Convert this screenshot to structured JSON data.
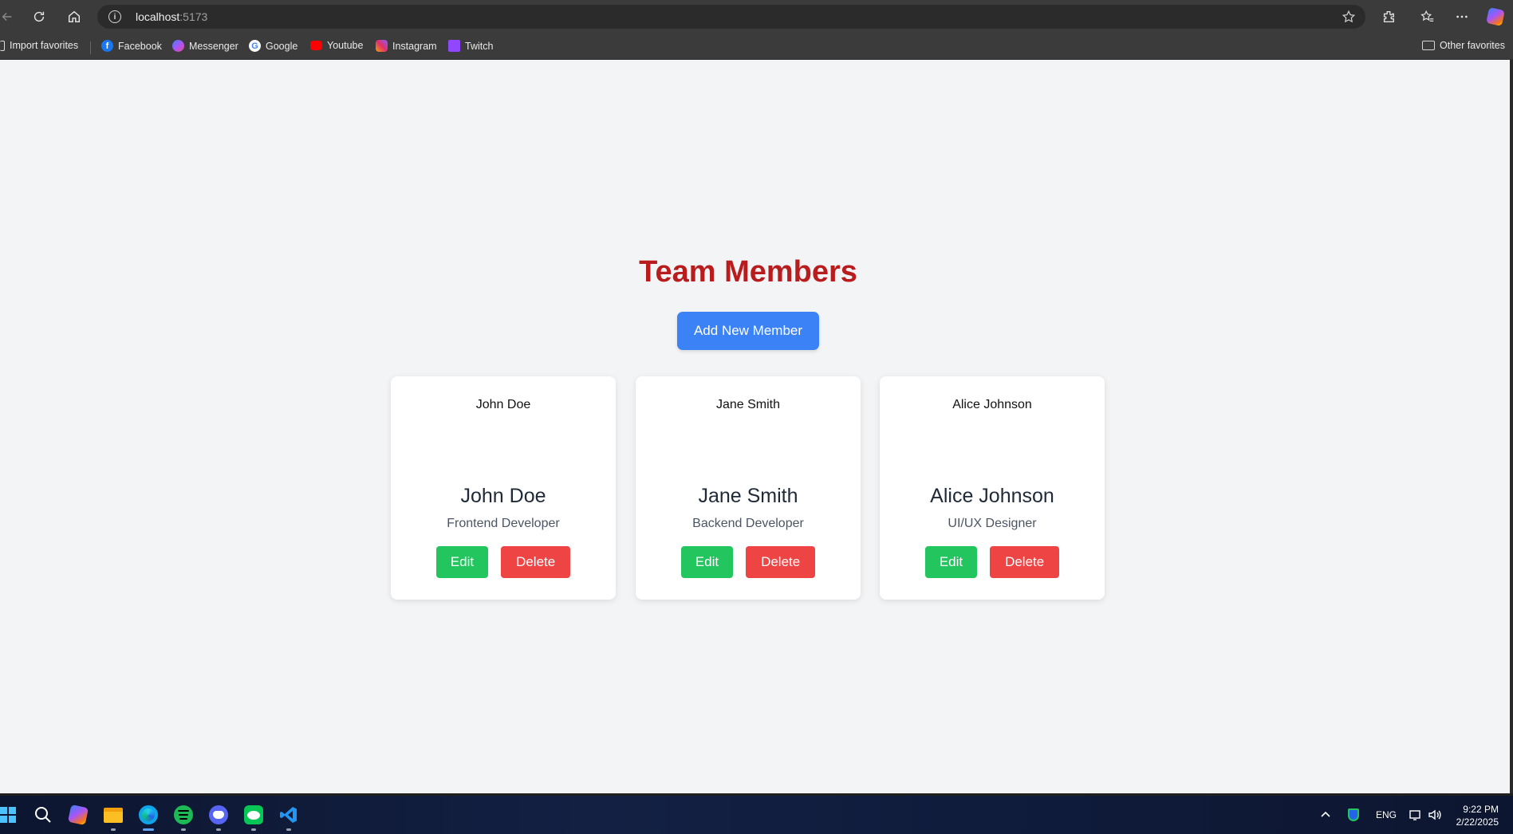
{
  "browser": {
    "url_host": "localhost",
    "url_port": ":5173",
    "bookmarks": [
      {
        "label": "Import favorites",
        "icon": "import-icon"
      },
      {
        "label": "Facebook",
        "icon": "facebook-icon",
        "color": "#1877f2"
      },
      {
        "label": "Messenger",
        "icon": "messenger-icon",
        "color": "#a855f7"
      },
      {
        "label": "Google",
        "icon": "google-icon",
        "color": "#ffffff"
      },
      {
        "label": "Youtube",
        "icon": "youtube-icon",
        "color": "#ff0000"
      },
      {
        "label": "Instagram",
        "icon": "instagram-icon",
        "color": "#e1306c"
      },
      {
        "label": "Twitch",
        "icon": "twitch-icon",
        "color": "#9146ff"
      }
    ],
    "other_favorites": "Other favorites"
  },
  "page": {
    "title": "Team Members",
    "add_button": "Add New Member",
    "title_color": "#b91c1c",
    "accent_color": "#3b82f6"
  },
  "members": [
    {
      "img_alt": "John Doe",
      "name": "John Doe",
      "role": "Frontend Developer"
    },
    {
      "img_alt": "Jane Smith",
      "name": "Jane Smith",
      "role": "Backend Developer"
    },
    {
      "img_alt": "Alice Johnson",
      "name": "Alice Johnson",
      "role": "UI/UX Designer"
    }
  ],
  "card_actions": {
    "edit": "Edit",
    "delete": "Delete",
    "edit_color": "#22c55e",
    "delete_color": "#ef4444"
  },
  "taskbar": {
    "apps": [
      "start-icon",
      "search-icon",
      "copilot-icon",
      "file-explorer-icon",
      "edge-icon",
      "spotify-icon",
      "discord-icon",
      "line-icon",
      "vscode-icon"
    ],
    "tray_lang": "ENG",
    "time": "9:22 PM",
    "date": "2/22/2025"
  }
}
